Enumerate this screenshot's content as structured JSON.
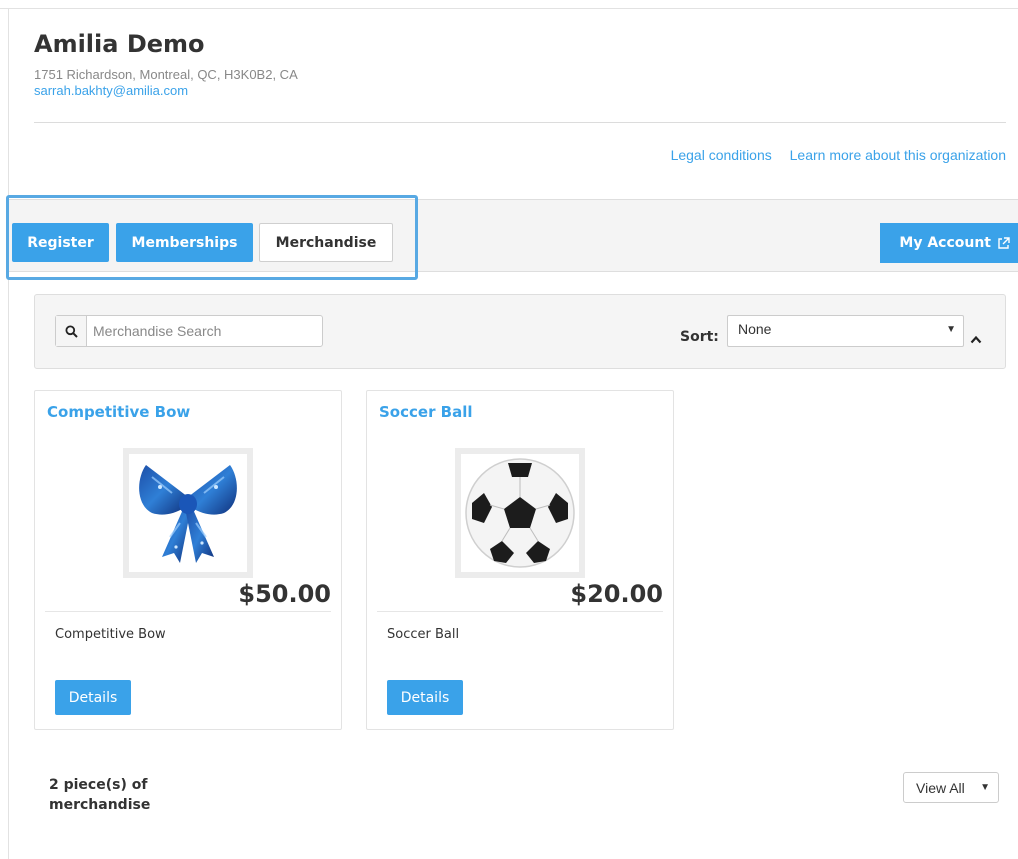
{
  "organization": {
    "name": "Amilia Demo",
    "address": "1751 Richardson, Montreal, QC, H3K0B2, CA",
    "email": "sarrah.bakhty@amilia.com"
  },
  "links": {
    "legal": "Legal conditions",
    "learn_more": "Learn more about this organization"
  },
  "tabs": [
    {
      "label": "Register",
      "active": false
    },
    {
      "label": "Memberships",
      "active": false
    },
    {
      "label": "Merchandise",
      "active": true
    }
  ],
  "my_account": {
    "label": "My Account",
    "icon": "external-link-icon"
  },
  "search": {
    "placeholder": "Merchandise Search",
    "value": "",
    "icon": "search-icon"
  },
  "sort": {
    "label": "Sort:",
    "value": "None"
  },
  "products": [
    {
      "title": "Competitive Bow",
      "price": "$50.00",
      "description": "Competitive Bow",
      "button": "Details",
      "image": "blue-cheer-bow"
    },
    {
      "title": "Soccer Ball",
      "price": "$20.00",
      "description": "Soccer Ball",
      "button": "Details",
      "image": "soccer-ball"
    }
  ],
  "footer": {
    "count_text": "2 piece(s) of merchandise",
    "view_select": "View All"
  },
  "colors": {
    "accent": "#3aa2e9",
    "highlight": "#58a9e3",
    "panel": "#f5f5f5"
  }
}
